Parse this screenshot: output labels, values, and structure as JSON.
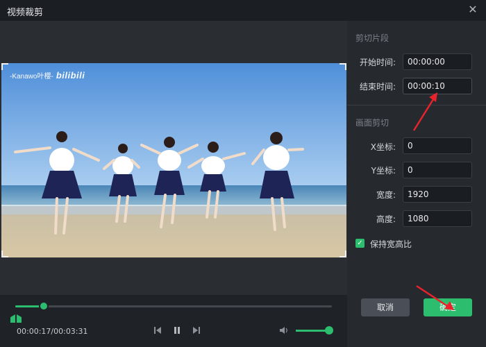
{
  "window": {
    "title": "视频裁剪",
    "close_icon": "close-icon"
  },
  "video": {
    "watermark_text": "-Kanawo叶樱-",
    "watermark_logo": "bilibili"
  },
  "player": {
    "progress": 0.09,
    "current_time": "00:00:17",
    "total_time": "00:03:31",
    "timecode": "00:00:17/00:03:31",
    "volume": 1.0
  },
  "clip_section": {
    "title": "剪切片段",
    "start_label": "开始时间:",
    "start_value": "00:00:00",
    "end_label": "结束时间:",
    "end_value": "00:00:10"
  },
  "crop_section": {
    "title": "画面剪切",
    "x_label": "X坐标:",
    "x_value": "0",
    "y_label": "Y坐标:",
    "y_value": "0",
    "width_label": "宽度:",
    "width_value": "1920",
    "height_label": "高度:",
    "height_value": "1080",
    "keep_ratio_label": "保持宽高比",
    "keep_ratio_checked": true
  },
  "buttons": {
    "cancel": "取消",
    "ok": "确定"
  },
  "colors": {
    "accent": "#2dbd6e",
    "annotation_arrow": "#e8232b"
  }
}
